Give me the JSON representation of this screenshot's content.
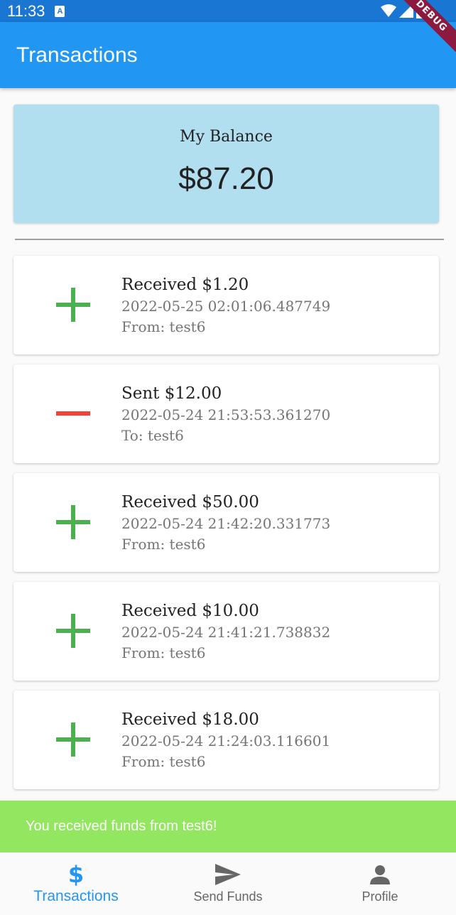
{
  "status_bar": {
    "time": "11:33",
    "icons": [
      "a-icon",
      "wifi-icon",
      "signal-icon",
      "battery-icon"
    ]
  },
  "app_bar": {
    "title": "Transactions",
    "debug_banner": "DEBUG"
  },
  "balance": {
    "label": "My Balance",
    "value": "$87.20"
  },
  "colors": {
    "app_bar": "#2196f3",
    "balance_card": "#b1dff0",
    "received": "#4caf50",
    "sent": "#f44336",
    "snackbar": "#93e760",
    "accent": "#2196f3"
  },
  "transactions": [
    {
      "type": "received",
      "icon": "plus-icon",
      "title": "Received $1.20",
      "date": "2022-05-25 02:01:06.487749",
      "party": "From: test6"
    },
    {
      "type": "sent",
      "icon": "minus-icon",
      "title": "Sent $12.00",
      "date": "2022-05-24 21:53:53.361270",
      "party": "To: test6"
    },
    {
      "type": "received",
      "icon": "plus-icon",
      "title": "Received $50.00",
      "date": "2022-05-24 21:42:20.331773",
      "party": "From: test6"
    },
    {
      "type": "received",
      "icon": "plus-icon",
      "title": "Received $10.00",
      "date": "2022-05-24 21:41:21.738832",
      "party": "From: test6"
    },
    {
      "type": "received",
      "icon": "plus-icon",
      "title": "Received $18.00",
      "date": "2022-05-24 21:24:03.116601",
      "party": "From: test6"
    }
  ],
  "snackbar": {
    "message": "You received funds from test6!"
  },
  "bottom_nav": {
    "items": [
      {
        "label": "Transactions",
        "icon": "dollar-icon",
        "active": true
      },
      {
        "label": "Send Funds",
        "icon": "send-icon",
        "active": false
      },
      {
        "label": "Profile",
        "icon": "person-icon",
        "active": false
      }
    ]
  }
}
